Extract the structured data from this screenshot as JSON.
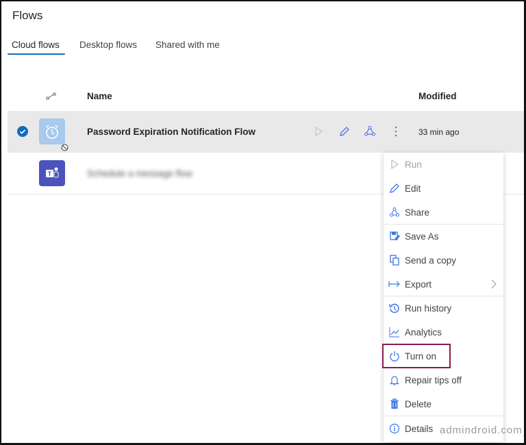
{
  "header": {
    "title": "Flows"
  },
  "tabs": [
    {
      "label": "Cloud flows",
      "active": true
    },
    {
      "label": "Desktop flows"
    },
    {
      "label": "Shared with me"
    }
  ],
  "columns": {
    "type_icon": "flow-type-icon",
    "name": "Name",
    "modified": "Modified"
  },
  "rows": [
    {
      "name": "Password Expiration Notification Flow",
      "modified": "33 min ago",
      "selected": true,
      "icon": "alarm-clock-icon",
      "disabled": true
    },
    {
      "name": "Schedule a message flow",
      "icon": "teams-icon",
      "blurred": true
    }
  ],
  "menu": [
    {
      "label": "Run",
      "icon": "play-icon",
      "disabled": true
    },
    {
      "label": "Edit",
      "icon": "pencil-icon"
    },
    {
      "label": "Share",
      "icon": "share-icon"
    },
    {
      "label": "Save As",
      "icon": "save-as-icon"
    },
    {
      "label": "Send a copy",
      "icon": "copy-icon"
    },
    {
      "label": "Export",
      "icon": "export-icon",
      "submenu": true
    },
    {
      "label": "Run history",
      "icon": "history-icon"
    },
    {
      "label": "Analytics",
      "icon": "analytics-icon"
    },
    {
      "label": "Turn on",
      "icon": "power-icon",
      "highlighted": true
    },
    {
      "label": "Repair tips off",
      "icon": "bell-icon"
    },
    {
      "label": "Delete",
      "icon": "trash-icon"
    },
    {
      "label": "Details",
      "icon": "info-icon"
    }
  ],
  "watermark": "admindroid.com",
  "colors": {
    "accent": "#0f6cbd",
    "highlight": "#8b1a52",
    "icon_blue": "#4f6bed"
  }
}
